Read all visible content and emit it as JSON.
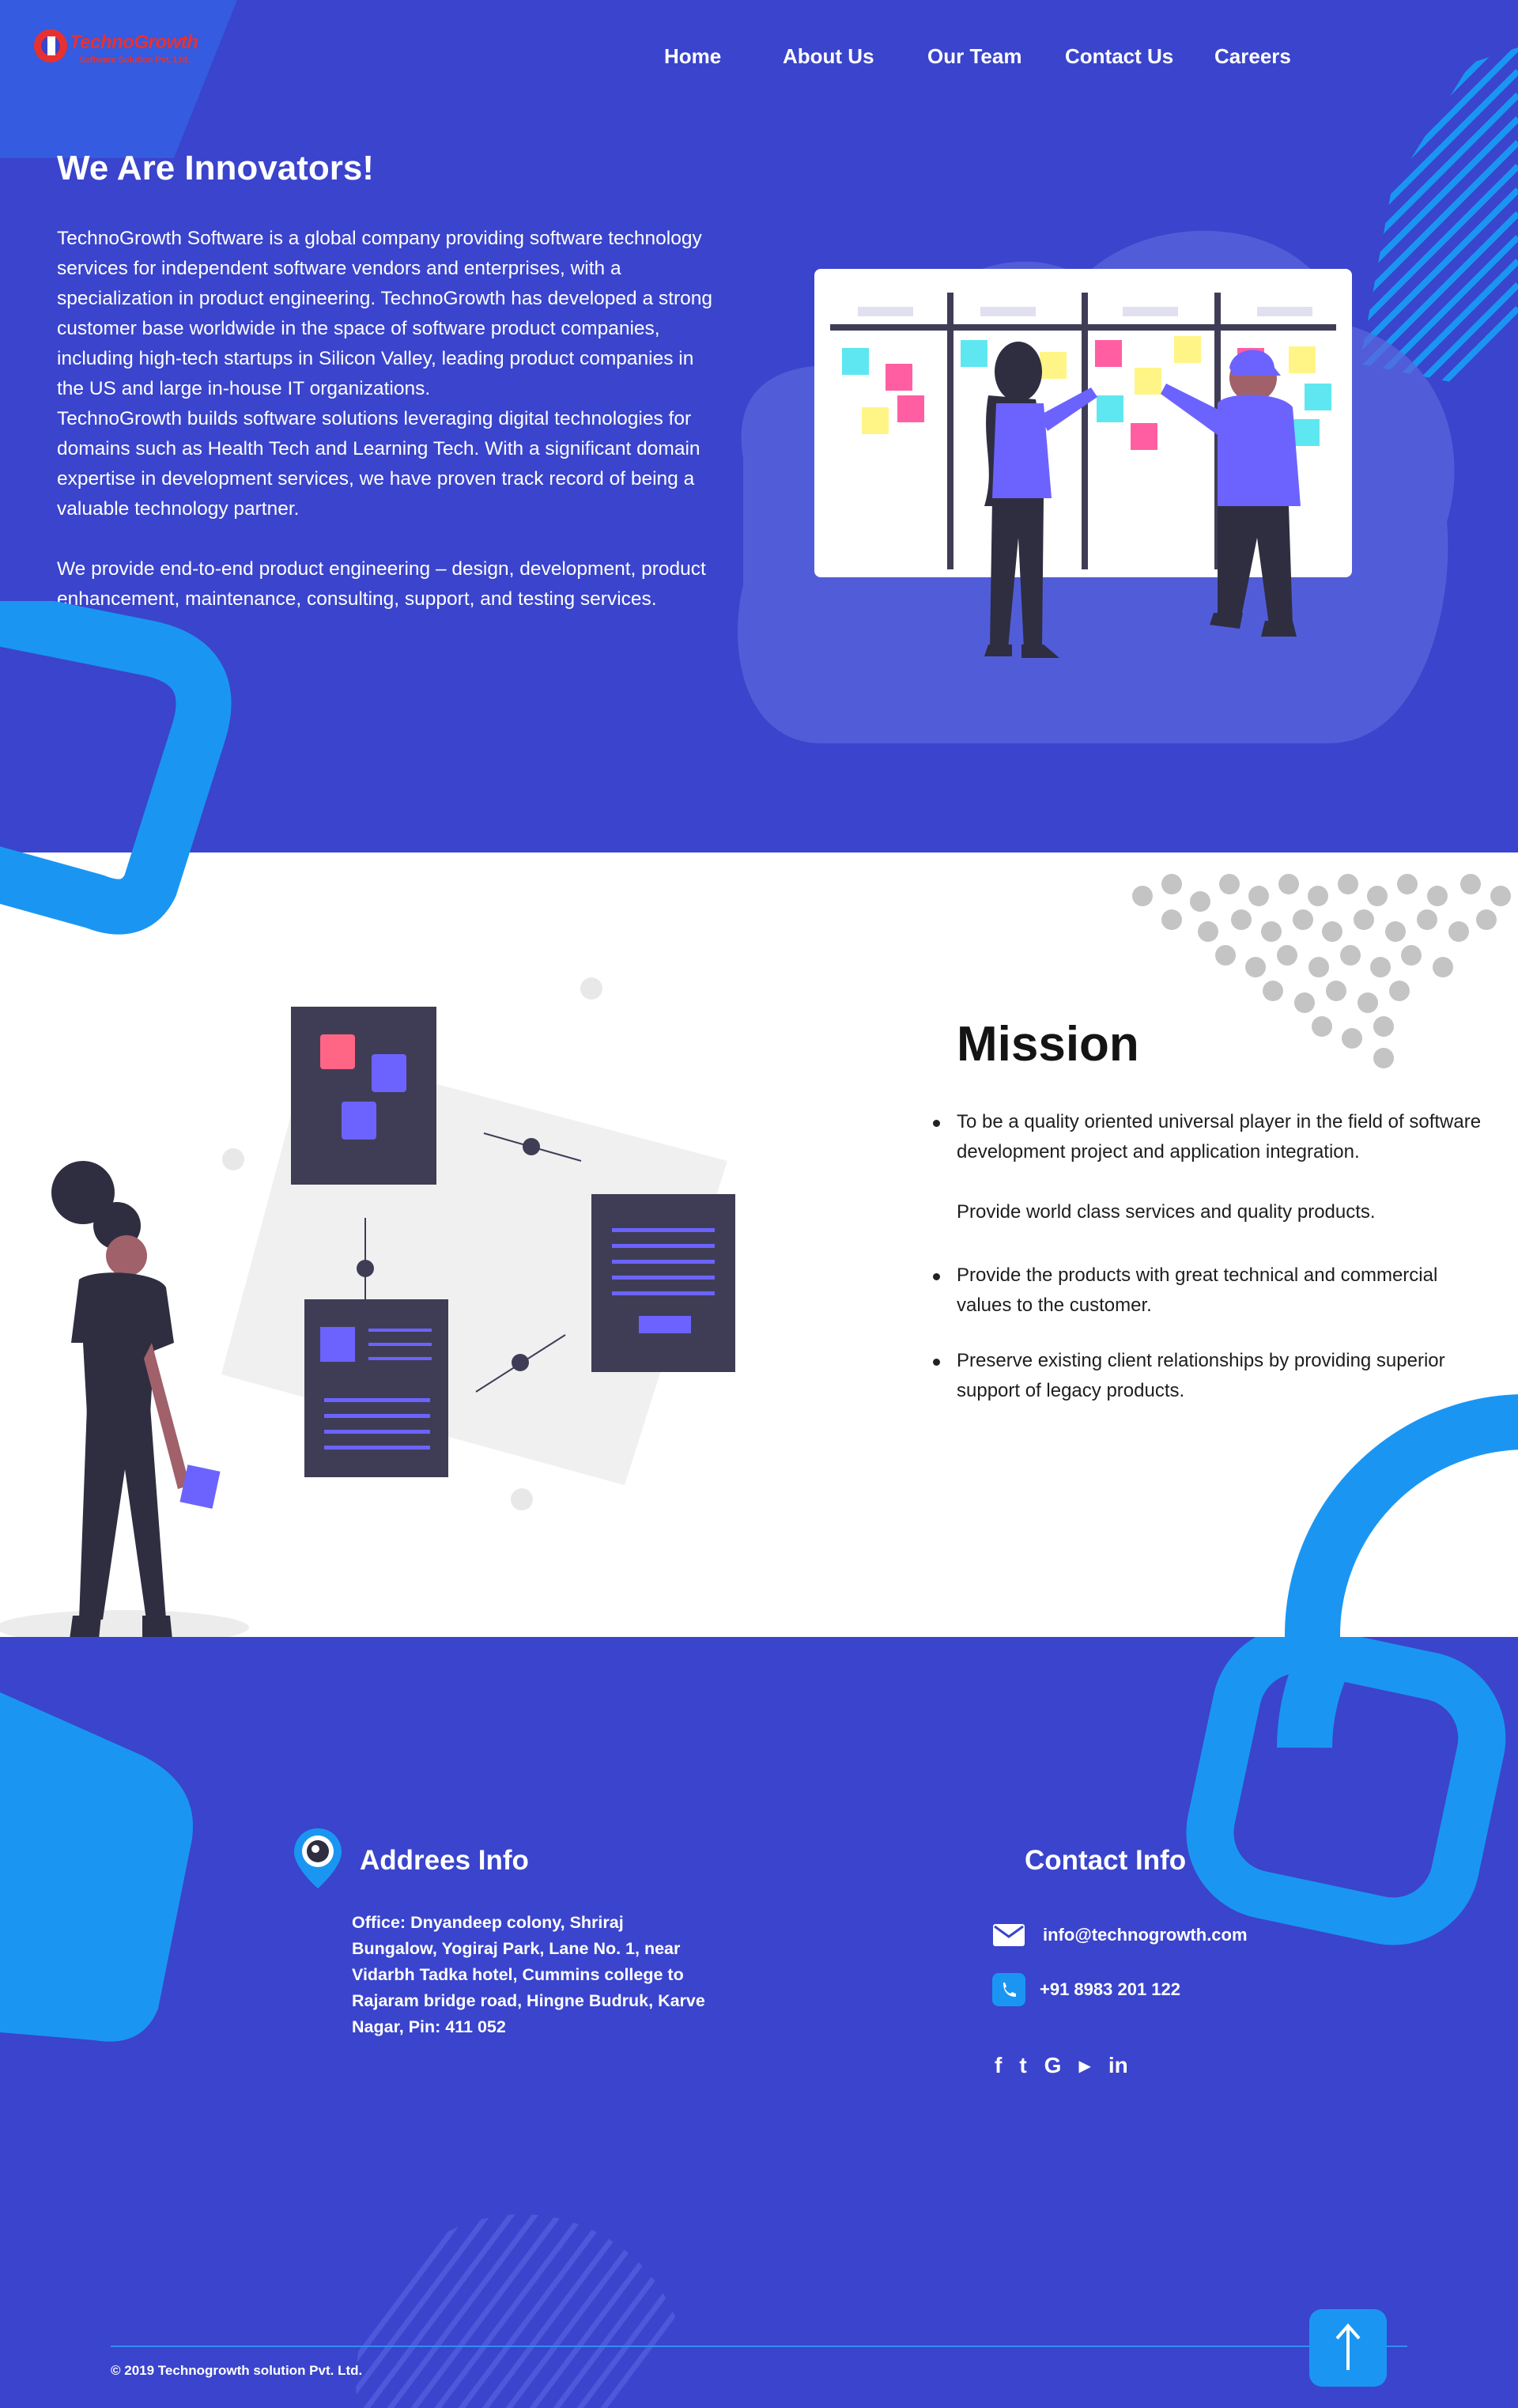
{
  "brand": {
    "name": "TechnoGrowth",
    "tagline": "Software Solution Pvt. Ltd."
  },
  "nav": {
    "items": [
      "Home",
      "About Us",
      "Our Team",
      "Contact Us",
      "Careers"
    ]
  },
  "hero": {
    "title": "We Are Innovators!",
    "paragraphs": [
      "TechnoGrowth Software is a global company providing software technology services for independent software vendors and enterprises, with a specialization in product engineering. TechnoGrowth has developed a strong customer base worldwide in the space of software product companies, including high-tech startups in Silicon Valley, leading product companies in the US and large in-house IT organizations.",
      "TechnoGrowth builds software solutions leveraging digital technologies for domains such as Health Tech and Learning Tech. With a significant domain expertise in development services, we have proven track record of being a valuable technology partner.",
      "We provide end-to-end product engineering – design, development, product enhancement, maintenance, consulting, support, and testing services."
    ]
  },
  "mission": {
    "title": "Mission",
    "items": [
      "To be a quality oriented universal player in the field of software development project and application integration.",
      "Provide world class services and quality products.",
      "Provide the products with great technical and commercial values to the customer.",
      "Preserve existing client relationships by providing superior support of legacy products."
    ]
  },
  "address": {
    "heading": "Addrees Info",
    "lines": [
      "Office: Dnyandeep colony, Shriraj",
      "Bungalow, Yogiraj Park, Lane No. 1, near",
      "Vidarbh Tadka hotel, Cummins college to",
      "Rajaram bridge road, Hingne Budruk, Karve",
      "Nagar, Pin: 411 052"
    ]
  },
  "contact": {
    "heading": "Contact Info",
    "email": "info@technogrowth.com",
    "phone": "+91 8983 201 122",
    "socials": [
      "f",
      "t",
      "G",
      "▶",
      "in"
    ]
  },
  "footer": {
    "copyright": "© 2019 Technogrowth solution Pvt.  Ltd."
  },
  "colors": {
    "primary": "#3a44cc",
    "accent": "#1a96f2",
    "white": "#ffffff",
    "text": "#141414"
  },
  "icons": [
    "location-pin-icon",
    "mail-icon",
    "phone-icon",
    "facebook-icon",
    "twitter-icon",
    "google-icon",
    "youtube-icon",
    "linkedin-icon",
    "arrow-up-icon"
  ]
}
